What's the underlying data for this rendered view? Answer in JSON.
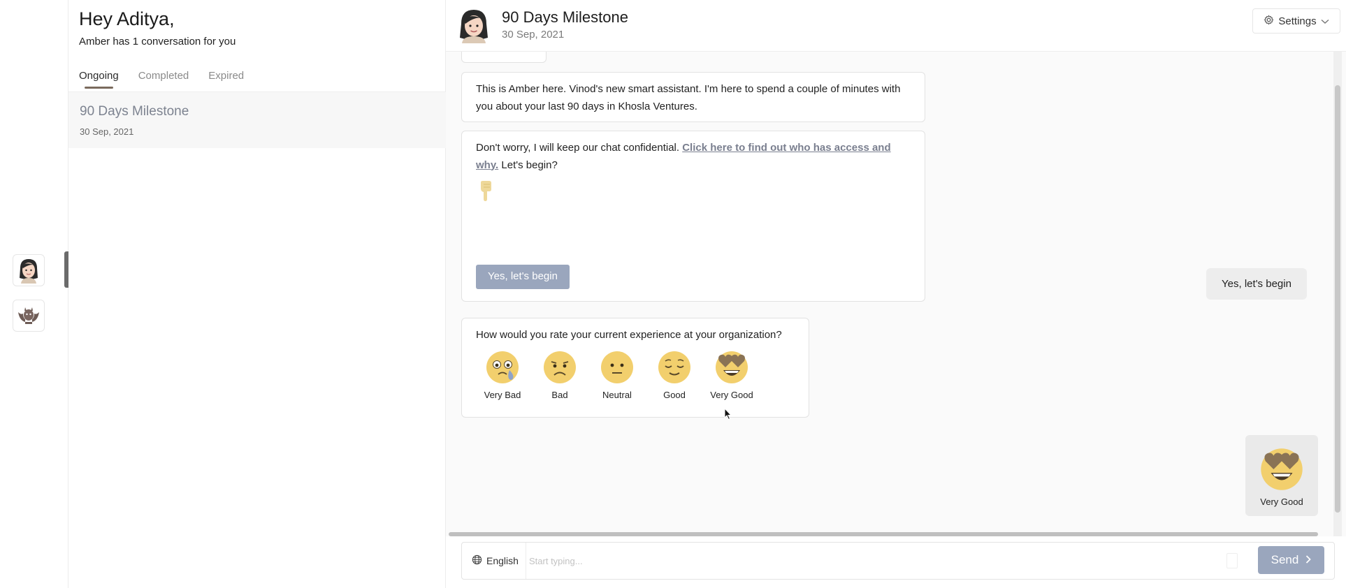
{
  "sidebar": {
    "greeting": "Hey Aditya,",
    "subtitle": "Amber has 1 conversation for you",
    "tabs": [
      {
        "label": "Ongoing",
        "active": true
      },
      {
        "label": "Completed",
        "active": false
      },
      {
        "label": "Expired",
        "active": false
      }
    ],
    "conversations": [
      {
        "title": "90 Days Milestone",
        "date": "30 Sep, 2021"
      }
    ]
  },
  "rail": {
    "avatars": [
      {
        "name": "amber-avatar-icon"
      },
      {
        "name": "bat-avatar-icon"
      }
    ]
  },
  "header": {
    "title": "90 Days Milestone",
    "date": "30 Sep, 2021",
    "settings_label": "Settings"
  },
  "messages": {
    "intro": "This is Amber here. Vinod's new smart assistant. I'm here to spend a couple of minutes with you about your last 90 days in Khosla Ventures.",
    "confidential_prefix": "Don't worry, I will keep our chat confidential. ",
    "access_link": "Click here to find out who has access and why.",
    "confidential_suffix": " Let's begin?",
    "begin_button": "Yes, let's begin",
    "user_reply": "Yes, let's begin",
    "rating_question": "How would you rate your current experience at your organization?",
    "rating_options": [
      {
        "label": "Very Bad",
        "icon": "crying-face-icon"
      },
      {
        "label": "Bad",
        "icon": "frowning-face-icon"
      },
      {
        "label": "Neutral",
        "icon": "neutral-face-icon"
      },
      {
        "label": "Good",
        "icon": "relieved-face-icon"
      },
      {
        "label": "Very Good",
        "icon": "heart-eyes-face-icon"
      }
    ],
    "selected_answer": "Very Good"
  },
  "composer": {
    "language": "English",
    "placeholder": "Start typing...",
    "send_label": "Send"
  },
  "colors": {
    "accent": "#9aa6bd",
    "emoji_yellow": "#f2cf6d",
    "tab_underline": "#7a6a5d"
  }
}
